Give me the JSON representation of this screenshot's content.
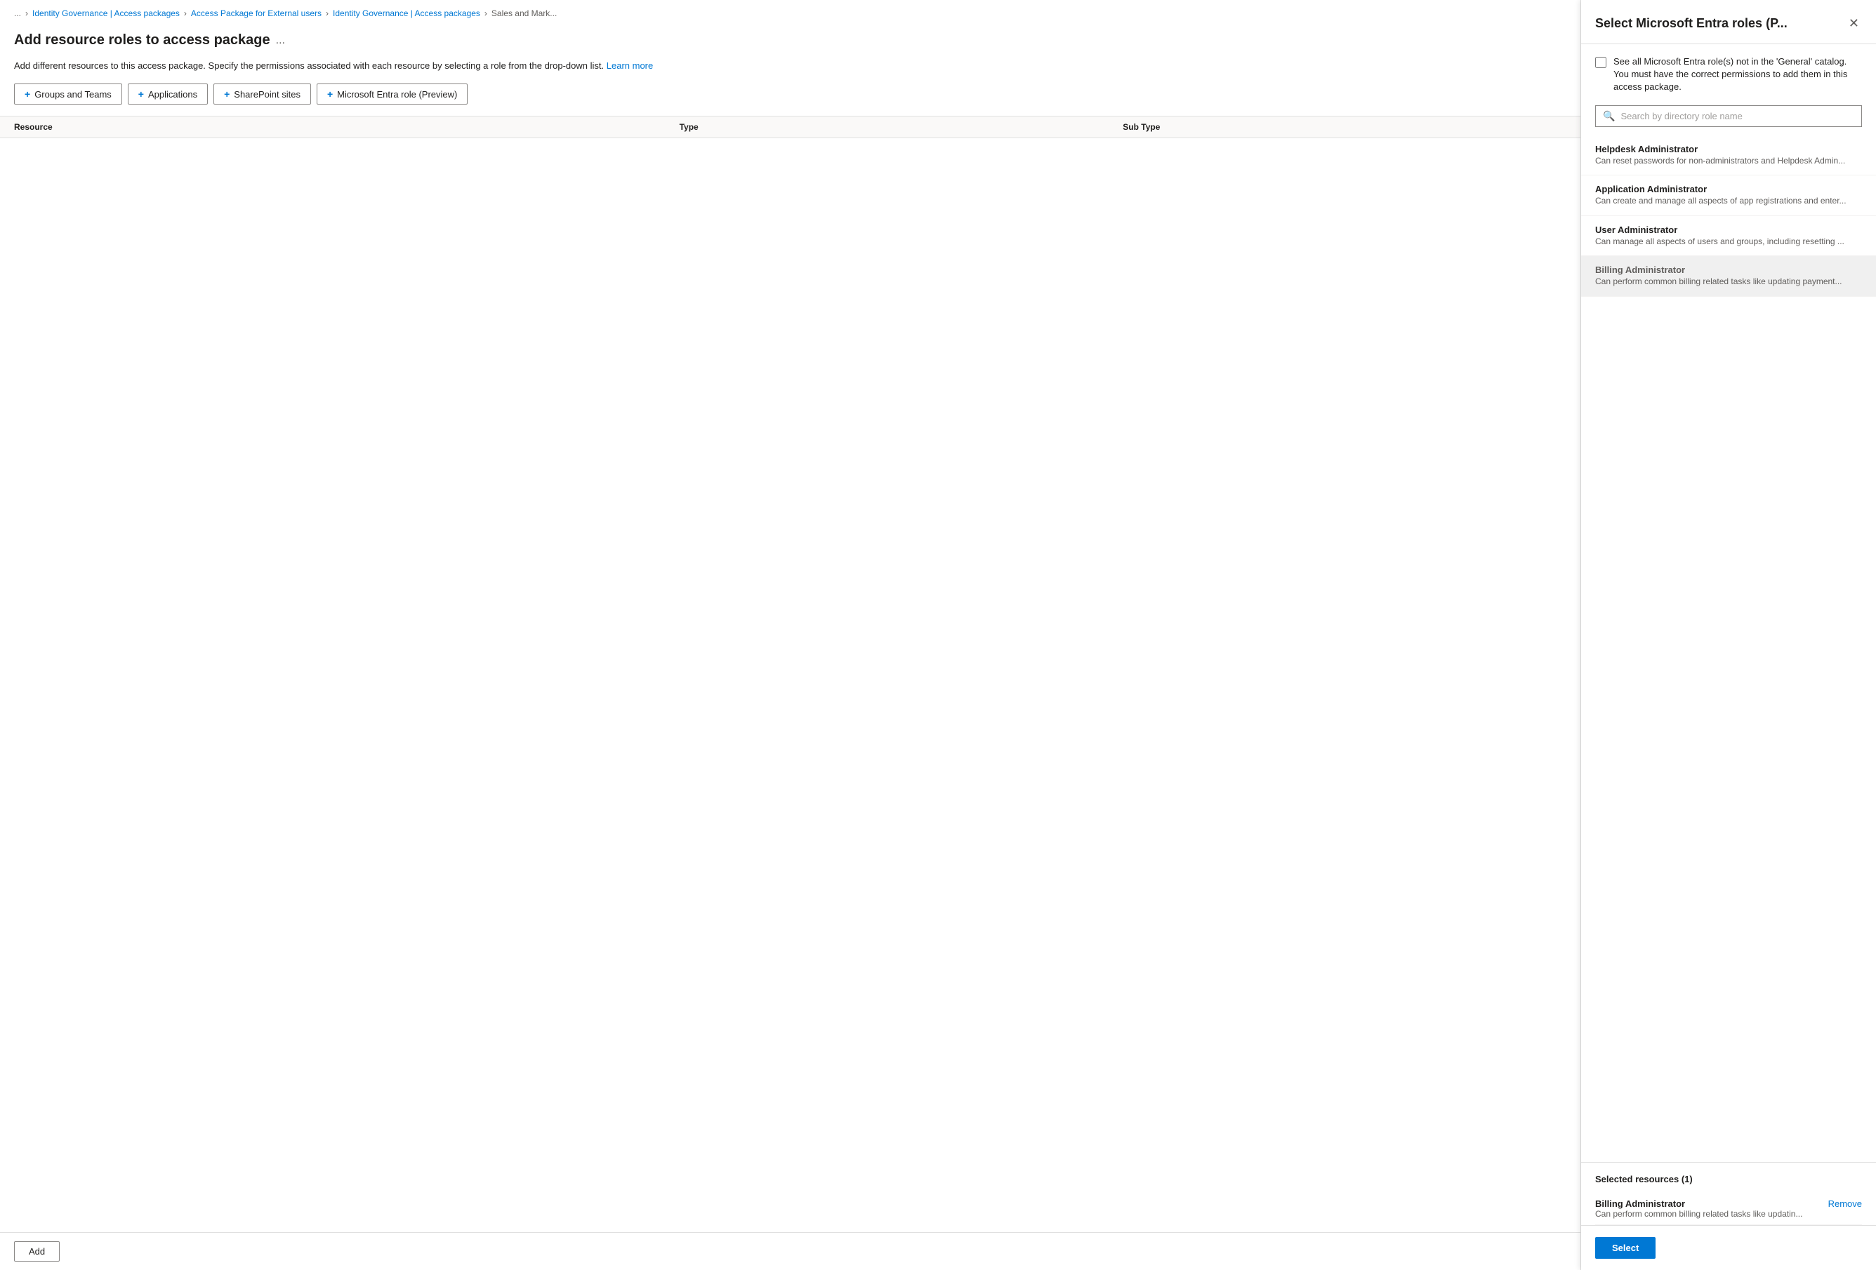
{
  "breadcrumb": {
    "ellipsis": "...",
    "items": [
      {
        "label": "Identity Governance | Access packages",
        "href": "#"
      },
      {
        "label": "Access Package for External users",
        "href": "#"
      },
      {
        "label": "Identity Governance | Access packages",
        "href": "#"
      },
      {
        "label": "Sales and Mark...",
        "href": "#"
      }
    ]
  },
  "page": {
    "title": "Add resource roles to access package",
    "title_ellipsis": "...",
    "description": "Add different resources to this access package. Specify the permissions associated with each resource by selecting a role from the drop-down list.",
    "learn_more": "Learn more"
  },
  "toolbar": {
    "buttons": [
      {
        "label": "Groups and Teams"
      },
      {
        "label": "Applications"
      },
      {
        "label": "SharePoint sites"
      },
      {
        "label": "Microsoft Entra role (Preview)"
      }
    ]
  },
  "table": {
    "columns": [
      {
        "label": "Resource"
      },
      {
        "label": "Type"
      },
      {
        "label": "Sub Type"
      }
    ]
  },
  "bottom": {
    "add_label": "Add"
  },
  "side_panel": {
    "title": "Select Microsoft Entra roles (P...",
    "close_icon": "✕",
    "checkbox_label": "See all Microsoft Entra role(s) not in the 'General' catalog. You must have the correct permissions to add them in this access package.",
    "search_placeholder": "Search by directory role name",
    "search_icon": "🔍",
    "roles": [
      {
        "name": "Helpdesk Administrator",
        "desc": "Can reset passwords for non-administrators and Helpdesk Admin...",
        "selected": false
      },
      {
        "name": "Application Administrator",
        "desc": "Can create and manage all aspects of app registrations and enter...",
        "selected": false
      },
      {
        "name": "User Administrator",
        "desc": "Can manage all aspects of users and groups, including resetting ...",
        "selected": false
      },
      {
        "name": "Billing Administrator",
        "desc": "Can perform common billing related tasks like updating payment...",
        "selected": true
      }
    ],
    "selected_resources_title": "Selected resources (1)",
    "selected_resources": [
      {
        "name": "Billing Administrator",
        "desc": "Can perform common billing related tasks like updatin...",
        "remove_label": "Remove"
      }
    ],
    "select_button_label": "Select"
  }
}
